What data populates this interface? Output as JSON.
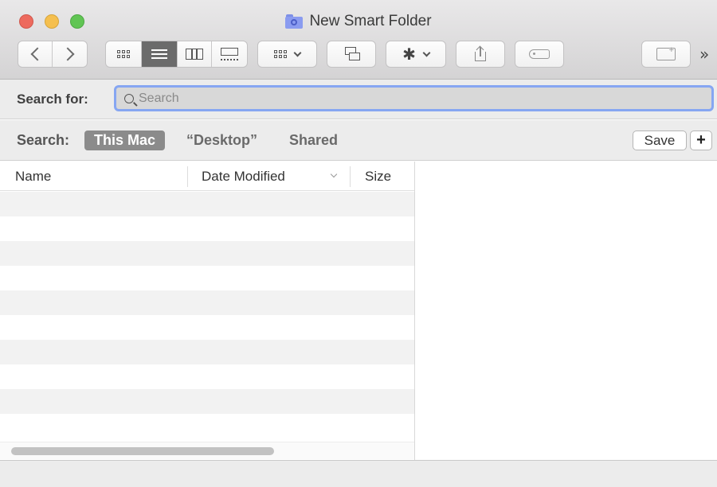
{
  "window": {
    "title": "New Smart Folder"
  },
  "toolbar": {
    "overflow_glyph": "»",
    "gear_glyph": "✱"
  },
  "search_for": {
    "label": "Search for:",
    "placeholder": "Search"
  },
  "scope": {
    "label": "Search:",
    "options": [
      "This Mac",
      "“Desktop”",
      "Shared"
    ],
    "selected": "This Mac",
    "save_label": "Save",
    "add_label": "+"
  },
  "list": {
    "columns": [
      "Name",
      "Date Modified",
      "Size"
    ]
  },
  "colors": {
    "focus_ring": "#86a6f2",
    "selected_scope": "#8b8b8b",
    "smart_folder_icon": "#8a9bf0"
  }
}
